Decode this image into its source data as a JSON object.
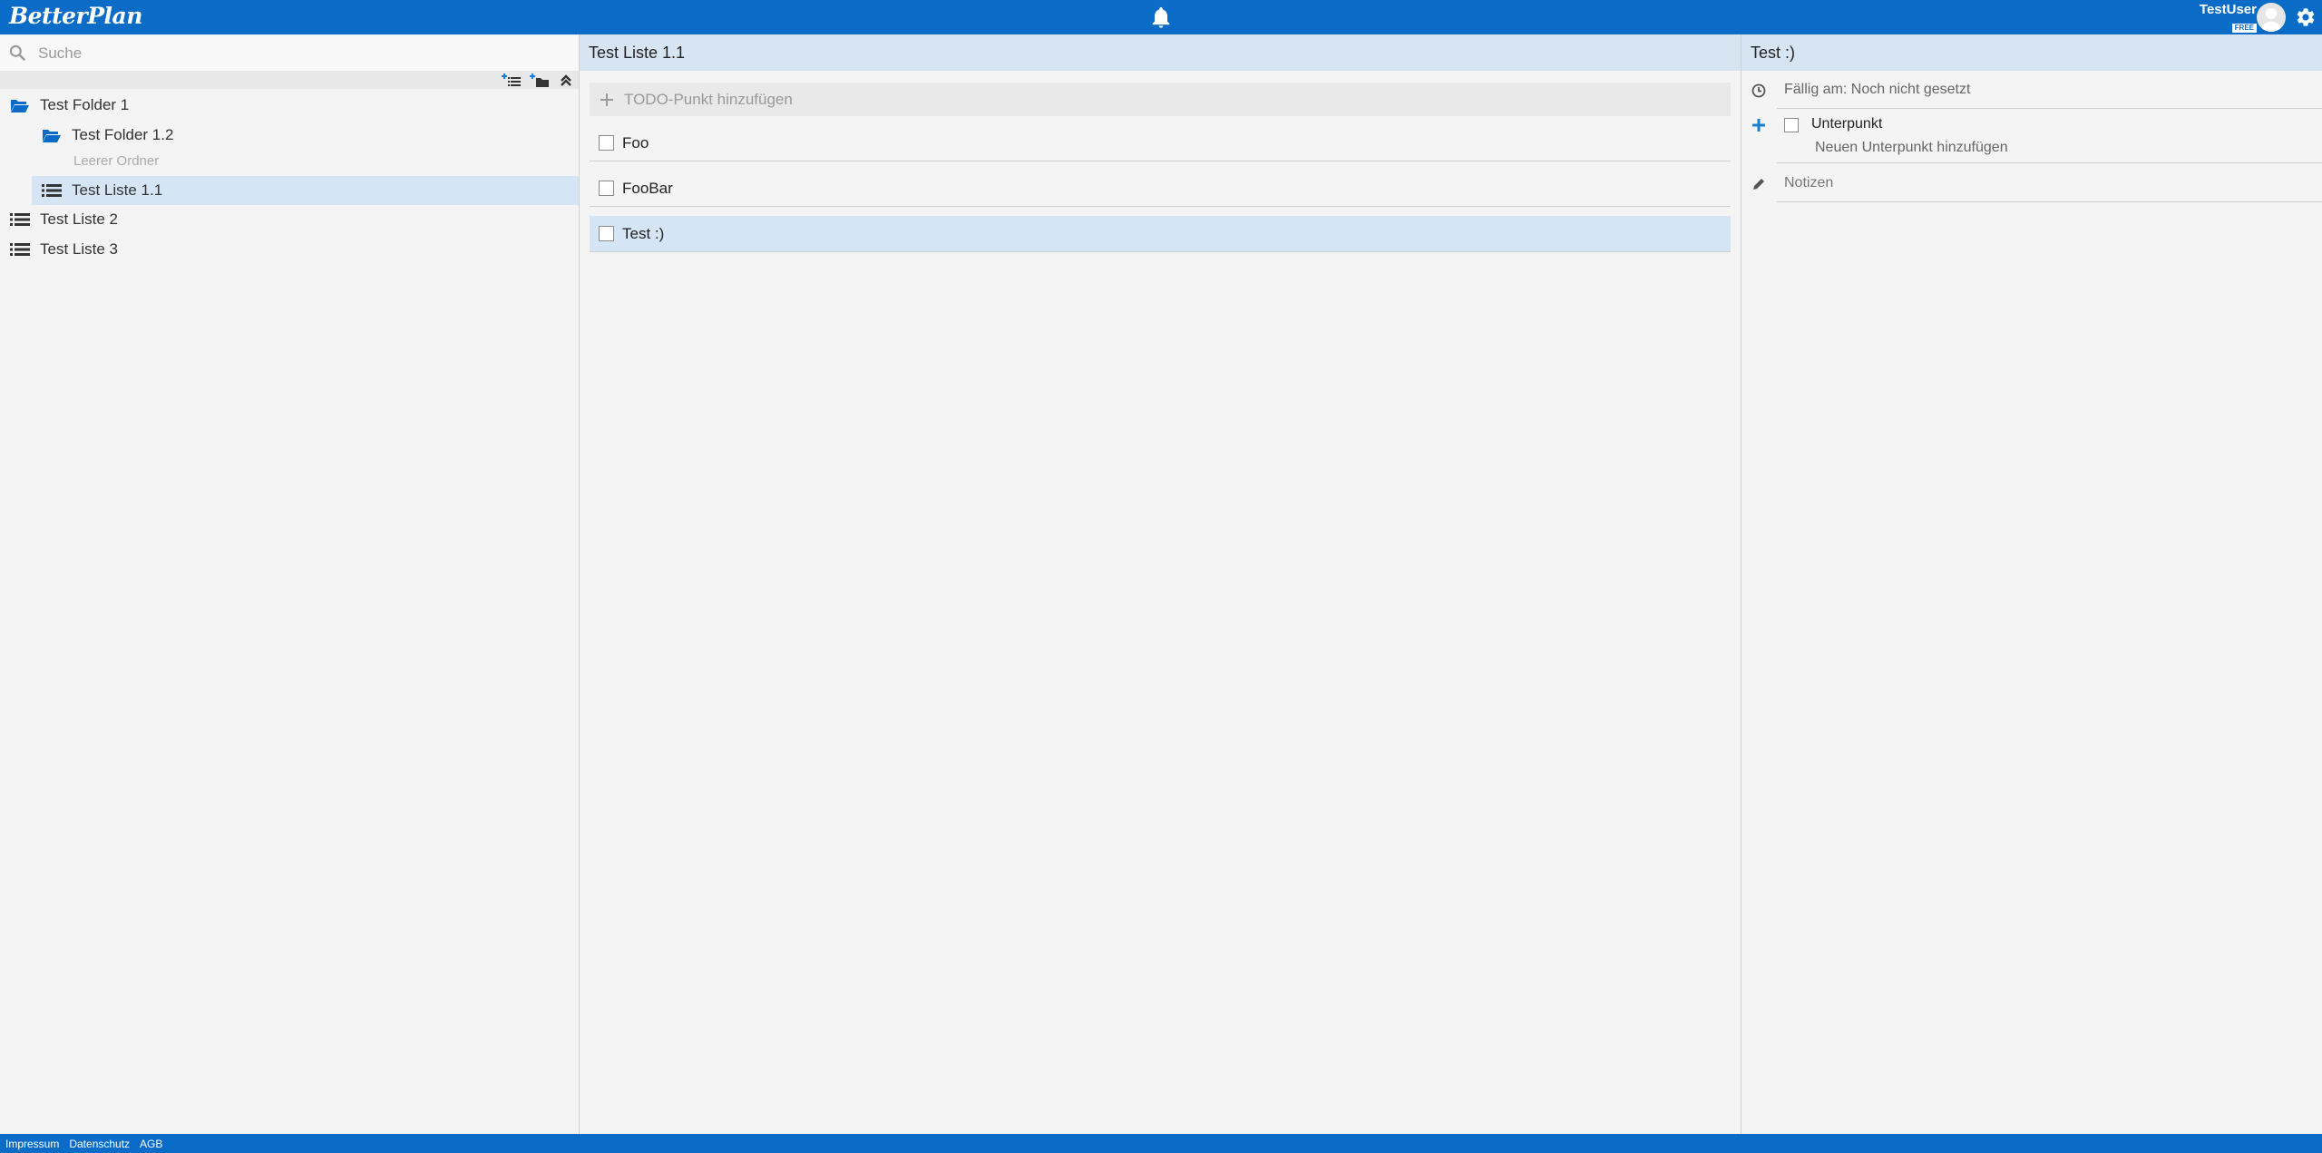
{
  "app": {
    "logo": "BetterPlan",
    "brand_color": "#0a6cc6",
    "selected_color": "#d5e5f5"
  },
  "topbar": {
    "notification_icon": "bell-icon",
    "username": "TestUser",
    "plan_badge": "FREE",
    "settings_icon": "gear-icon"
  },
  "sidebar": {
    "search_placeholder": "Suche",
    "tools": [
      "add-list-icon",
      "add-folder-icon",
      "collapse-all-icon"
    ],
    "tree": [
      {
        "label": "Test Folder 1",
        "type": "folder-open"
      },
      {
        "label": "Test Folder 1.2",
        "type": "folder-open"
      },
      {
        "label": "Test Liste 1.1",
        "type": "list",
        "selected": true
      },
      {
        "label": "Test Liste 2",
        "type": "list"
      },
      {
        "label": "Test Liste 3",
        "type": "list"
      }
    ],
    "empty_folder_note": "Leerer Ordner"
  },
  "list_panel": {
    "title": "Test Liste 1.1",
    "add_todo_placeholder": "TODO-Punkt hinzufügen",
    "todos": [
      {
        "label": "Foo",
        "checked": false
      },
      {
        "label": "FooBar",
        "checked": false
      },
      {
        "label": "Test :)",
        "checked": false,
        "selected": true
      }
    ]
  },
  "detail_panel": {
    "title": "Test :)",
    "due": "Fällig am: Noch nicht gesetzt",
    "subtask_label": "Unterpunkt",
    "add_subtask": "Neuen Unterpunkt hinzufügen",
    "notes_placeholder": "Notizen"
  },
  "footer": {
    "links": [
      "Impressum",
      "Datenschutz",
      "AGB"
    ]
  }
}
